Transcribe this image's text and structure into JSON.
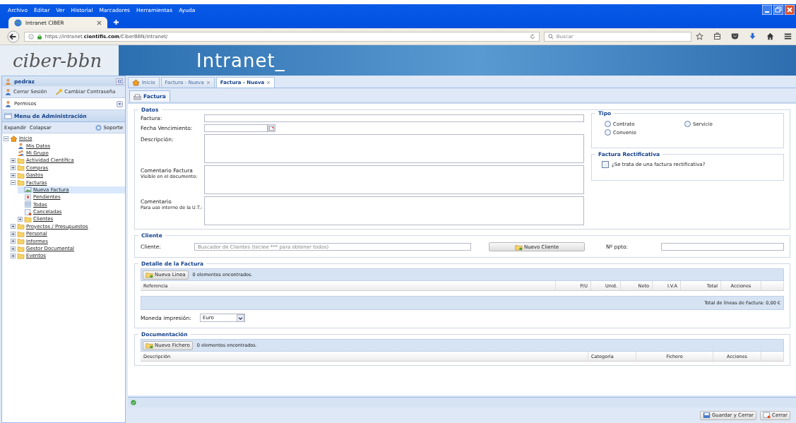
{
  "browser": {
    "menu": [
      "Archivo",
      "Editar",
      "Ver",
      "Historial",
      "Marcadores",
      "Herramientas",
      "Ayuda"
    ],
    "tab": {
      "title": "Intranet CIBER"
    },
    "url": {
      "prefix": "https://intranet.",
      "domain": "cientifis.com",
      "path": "/CiberBBN/intranet/"
    },
    "search": {
      "placeholder": "Buscar"
    }
  },
  "header": {
    "logo": "ciber-bbn",
    "title": "Intranet_"
  },
  "sidebar": {
    "user": "pedraz",
    "actions": [
      "Cerrar Sesión",
      "Cambiar Contraseña"
    ],
    "permisos": "Permisos",
    "menu_title": "Menu de Administración",
    "expand": "Expandir",
    "collapse": "Colapsar",
    "support": "Soporte",
    "tree": [
      {
        "label": "Inicio",
        "kind": "home",
        "expanded": true,
        "selected": false,
        "children": [
          {
            "label": "Mis Datos",
            "kind": "user",
            "selected": false
          },
          {
            "label": "Mi Grupo",
            "kind": "group",
            "selected": false
          },
          {
            "label": "Actividad Científica",
            "kind": "folder",
            "expanded": false,
            "selected": false
          },
          {
            "label": "Compras",
            "kind": "folder",
            "expanded": false,
            "selected": false
          },
          {
            "label": "Gastos",
            "kind": "folder",
            "expanded": false,
            "selected": false
          },
          {
            "label": "Facturas",
            "kind": "folder",
            "expanded": true,
            "selected": false,
            "children": [
              {
                "label": "Nueva Factura",
                "kind": "new",
                "selected": true
              },
              {
                "label": "Pendientes",
                "kind": "pending",
                "selected": false
              },
              {
                "label": "Todas",
                "kind": "list",
                "selected": false
              },
              {
                "label": "Canceladas",
                "kind": "cancel",
                "selected": false
              },
              {
                "label": "Clientes",
                "kind": "folder",
                "expanded": false,
                "selected": false
              }
            ]
          },
          {
            "label": "Proyectos / Presupuestos",
            "kind": "folder",
            "expanded": false,
            "selected": false
          },
          {
            "label": "Personal",
            "kind": "folder",
            "expanded": false,
            "selected": false
          },
          {
            "label": "Informes",
            "kind": "folder",
            "expanded": false,
            "selected": false
          },
          {
            "label": "Gestor Documental",
            "kind": "folder",
            "expanded": false,
            "selected": false
          },
          {
            "label": "Eventos",
            "kind": "folder",
            "expanded": false,
            "selected": false
          }
        ]
      }
    ]
  },
  "tabs": [
    {
      "label": "Inicio",
      "kind": "home",
      "selected": false,
      "closable": false
    },
    {
      "label": "Factura - Nueva",
      "kind": "plain",
      "selected": false,
      "closable": true
    },
    {
      "label": "Factura - Nueva",
      "kind": "plain",
      "selected": true,
      "closable": true
    }
  ],
  "subtab": {
    "label": "Factura",
    "selected": true
  },
  "datos": {
    "legend": "Datos",
    "factura_label": "Factura:",
    "fecha_label": "Fecha Vencimiento:",
    "descripcion_label": "Descripción:",
    "comentario_factura": {
      "label": "Comentario Factura",
      "hint": "Visible en el documento:"
    },
    "comentario": {
      "label": "Comentario",
      "hint": "Para uso interno de la U.T.:"
    }
  },
  "tipo": {
    "legend": "Tipo",
    "options": [
      {
        "label": "Contrato",
        "selected": false
      },
      {
        "label": "Servicio",
        "selected": false
      },
      {
        "label": "Convenio",
        "selected": false
      }
    ]
  },
  "rectificativa": {
    "legend": "Factura Rectificativa",
    "label": "¿Se trata de una factura rectificativa?",
    "checked": false
  },
  "cliente": {
    "legend": "Cliente",
    "label": "Cliente:",
    "placeholder": "Buscador de Clientes (teclee *** para obtener todos)",
    "button": "Nuevo Cliente",
    "ppto_label": "Nº ppto:"
  },
  "detalle": {
    "legend": "Detalle de la Factura",
    "button": "Nueva Linea",
    "count": "0 elementos encontrados.",
    "columns": [
      "Referencia",
      "P/U",
      "Unid.",
      "Neto",
      "I.V.A",
      "Total",
      "Acciones"
    ],
    "total": "Total de líneas de Factura: 0,00 €",
    "moneda_label": "Moneda impresión:",
    "moneda_value": "Euro"
  },
  "documentacion": {
    "legend": "Documentación",
    "button": "Nuevo Fichero",
    "count": "0 elementos encontrados.",
    "columns": [
      "Descripción",
      "Categoría",
      "Fichero",
      "Acciones"
    ]
  },
  "footer": {
    "buttons": [
      "Guardar y Cerrar",
      "Cerrar"
    ]
  }
}
